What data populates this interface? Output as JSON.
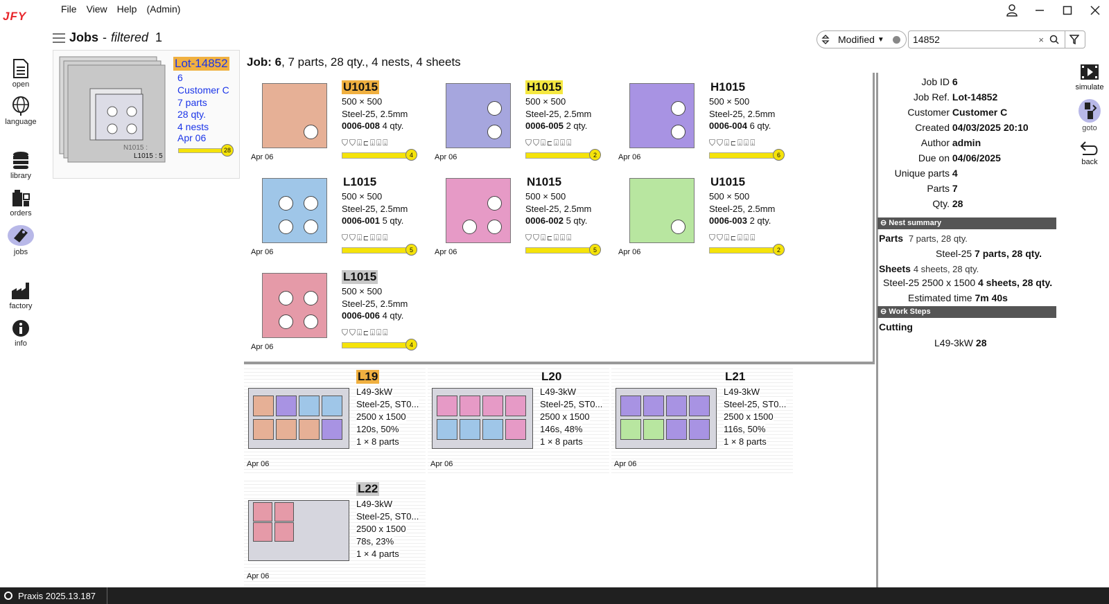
{
  "app": {
    "logo": "JFY"
  },
  "menu": [
    "File",
    "View",
    "Help",
    "(Admin)"
  ],
  "sidebar": [
    {
      "label": "open",
      "icon": "document-icon"
    },
    {
      "label": "language",
      "icon": "globe-icon"
    },
    {
      "label": "library",
      "icon": "database-icon"
    },
    {
      "label": "orders",
      "icon": "orders-icon"
    },
    {
      "label": "jobs",
      "icon": "tag-icon"
    },
    {
      "label": "factory",
      "icon": "factory-icon"
    },
    {
      "label": "info",
      "icon": "info-icon"
    }
  ],
  "header": {
    "title": "Jobs",
    "sep": "-",
    "filter_label": "filtered",
    "count": "1"
  },
  "sort": {
    "value": "Modified"
  },
  "search": {
    "value": "14852"
  },
  "lot": {
    "name": "Lot-14852",
    "job": "6",
    "customer": "Customer C",
    "parts": "7 parts",
    "qty": "28 qty.",
    "nests": "4 nests",
    "date": "Apr 06",
    "badge": "28",
    "thumb_label1": "N1015 : ",
    "thumb_label2": "L1015 : 5"
  },
  "job_title": {
    "bold": "Job: 6",
    "rest": ", 7 parts, 28 qty., 4 nests, 4 sheets"
  },
  "parts": [
    {
      "name": "U1015",
      "size": "500 × 500",
      "material": "Steel-25, 2.5mm",
      "code": "0006-008",
      "qty": "4 qty.",
      "date": "Apr 06",
      "badge": "4",
      "color": "#e6b096",
      "hl": "#f0b040",
      "progress": 1.0
    },
    {
      "name": "H1015",
      "size": "500 × 500",
      "material": "Steel-25, 2.5mm",
      "code": "0006-005",
      "qty": "2 qty.",
      "date": "Apr 06",
      "badge": "2",
      "color": "#a6a6de",
      "hl": "#f5e840",
      "progress": 1.0
    },
    {
      "name": "H1015",
      "size": "500 × 500",
      "material": "Steel-25, 2.5mm",
      "code": "0006-004",
      "qty": "6 qty.",
      "date": "Apr 06",
      "badge": "6",
      "color": "#a893e3",
      "hl": "",
      "progress": 1.0
    },
    {
      "name": "L1015",
      "size": "500 × 500",
      "material": "Steel-25, 2.5mm",
      "code": "0006-001",
      "qty": "5 qty.",
      "date": "Apr 06",
      "badge": "5",
      "color": "#9fc6e8",
      "hl": "",
      "progress": 1.0
    },
    {
      "name": "N1015",
      "size": "500 × 500",
      "material": "Steel-25, 2.5mm",
      "code": "0006-002",
      "qty": "5 qty.",
      "date": "Apr 06",
      "badge": "5",
      "color": "#e69ac6",
      "hl": "",
      "progress": 1.0
    },
    {
      "name": "U1015",
      "size": "500 × 500",
      "material": "Steel-25, 2.5mm",
      "code": "0006-003",
      "qty": "2 qty.",
      "date": "Apr 06",
      "badge": "2",
      "color": "#b8e6a0",
      "hl": "",
      "progress": 1.0
    },
    {
      "name": "L1015",
      "size": "500 × 500",
      "material": "Steel-25, 2.5mm",
      "code": "0006-006",
      "qty": "4 qty.",
      "date": "Apr 06",
      "badge": "4",
      "color": "#e59aa8",
      "hl": "#c8c8c8",
      "progress": 1.0
    }
  ],
  "nests": [
    {
      "name": "L19",
      "machine": "L49-3kW",
      "material": "Steel-25, ST0...",
      "sheet": "2500 x 1500",
      "time": "120s, 50%",
      "count": "1 × 8 parts",
      "date": "Apr 06",
      "hl": "#f0b040"
    },
    {
      "name": "L20",
      "machine": "L49-3kW",
      "material": "Steel-25, ST0...",
      "sheet": "2500 x 1500",
      "time": "146s, 48%",
      "count": "1 × 8 parts",
      "date": "Apr 06",
      "hl": ""
    },
    {
      "name": "L21",
      "machine": "L49-3kW",
      "material": "Steel-25, ST0...",
      "sheet": "2500 x 1500",
      "time": "116s, 50%",
      "count": "1 × 8 parts",
      "date": "Apr 06",
      "hl": ""
    },
    {
      "name": "L22",
      "machine": "L49-3kW",
      "material": "Steel-25, ST0...",
      "sheet": "2500 x 1500",
      "time": "78s, 23%",
      "count": "1 × 4 parts",
      "date": "Apr 06",
      "hl": "#c8c8c8"
    }
  ],
  "details": [
    {
      "k": "Job ID",
      "v": "6"
    },
    {
      "k": "Job Ref.",
      "v": "Lot-14852"
    },
    {
      "k": "Customer",
      "v": "Customer C"
    },
    {
      "k": "Created",
      "v": "04/03/2025 20:10"
    },
    {
      "k": "Author",
      "v": "admin"
    },
    {
      "k": "Due on",
      "v": "04/06/2025"
    },
    {
      "k": "Unique parts",
      "v": "4"
    },
    {
      "k": "Parts",
      "v": "7"
    },
    {
      "k": "Qty.",
      "v": "28"
    }
  ],
  "nest_summary": {
    "title": "Nest summary",
    "parts_label": "Parts",
    "parts_value": "7 parts, 28 qty.",
    "mat": "Steel-25",
    "mat_value": "7 parts, 28 qty.",
    "sheets_label": "Sheets",
    "sheets_value": "4 sheets, 28 qty.",
    "sheet_spec": "Steel-25 2500 x 1500",
    "sheet_spec_value": "4 sheets, 28 qty.",
    "est_label": "Estimated time",
    "est_value": "7m 40s"
  },
  "work_steps": {
    "title": "Work Steps",
    "step": "Cutting",
    "machine": "L49-3kW",
    "value": "28"
  },
  "right_nav": [
    {
      "label": "simulate"
    },
    {
      "label": "goto"
    },
    {
      "label": "back"
    }
  ],
  "status": {
    "text": "Praxis 2025.13.187"
  }
}
